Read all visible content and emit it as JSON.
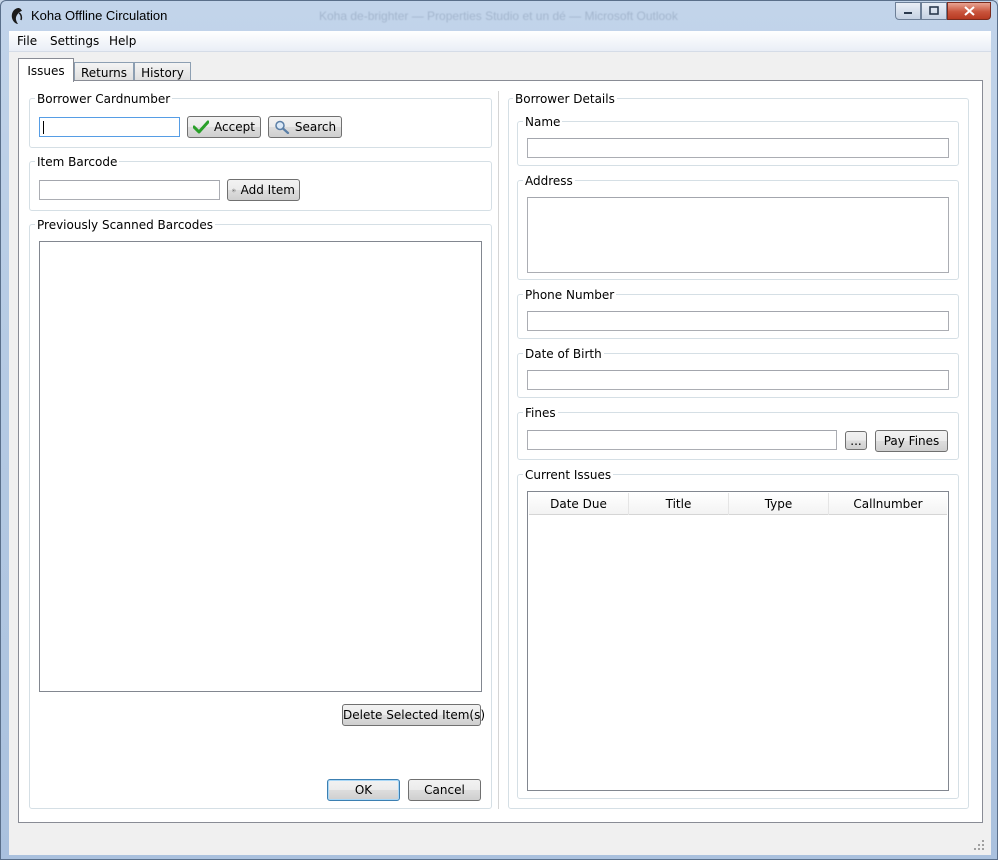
{
  "window": {
    "title": "Koha Offline Circulation",
    "background_title": "Koha de-brighter — Properties Studio et un dé — Microsoft Outlook"
  },
  "menu": [
    "File",
    "Settings",
    "Help"
  ],
  "tabs": [
    {
      "label": "Issues",
      "active": true
    },
    {
      "label": "Returns",
      "active": false
    },
    {
      "label": "History",
      "active": false
    }
  ],
  "issues": {
    "borrower_cardnumber": {
      "title": "Borrower Cardnumber",
      "value": "",
      "accept_label": "Accept",
      "search_label": "Search"
    },
    "item_barcode": {
      "title": "Item Barcode",
      "value": "",
      "add_label": "Add Item"
    },
    "previously_scanned": {
      "title": "Previously Scanned Barcodes",
      "items": []
    },
    "delete_label": "Delete Selected Item(s)",
    "ok_label": "OK",
    "cancel_label": "Cancel"
  },
  "borrower_details": {
    "title": "Borrower Details",
    "name": {
      "label": "Name",
      "value": ""
    },
    "address": {
      "label": "Address",
      "value": ""
    },
    "phone": {
      "label": "Phone Number",
      "value": ""
    },
    "dob": {
      "label": "Date of Birth",
      "value": ""
    },
    "fines": {
      "label": "Fines",
      "value": "",
      "browse_label": "...",
      "pay_label": "Pay Fines"
    },
    "current_issues": {
      "label": "Current Issues",
      "columns": [
        "Date Due",
        "Title",
        "Type",
        "Callnumber"
      ],
      "rows": []
    }
  },
  "colors": {
    "title_bar": "#b6cbe4",
    "accept_check": "#2aa02a",
    "delete_x": "#d42b2b",
    "focus_border": "#569de5"
  },
  "icons": {
    "accept": "checkmark-icon",
    "search": "magnifier-icon",
    "add": "plus-circle-icon",
    "delete": "red-x-icon"
  }
}
